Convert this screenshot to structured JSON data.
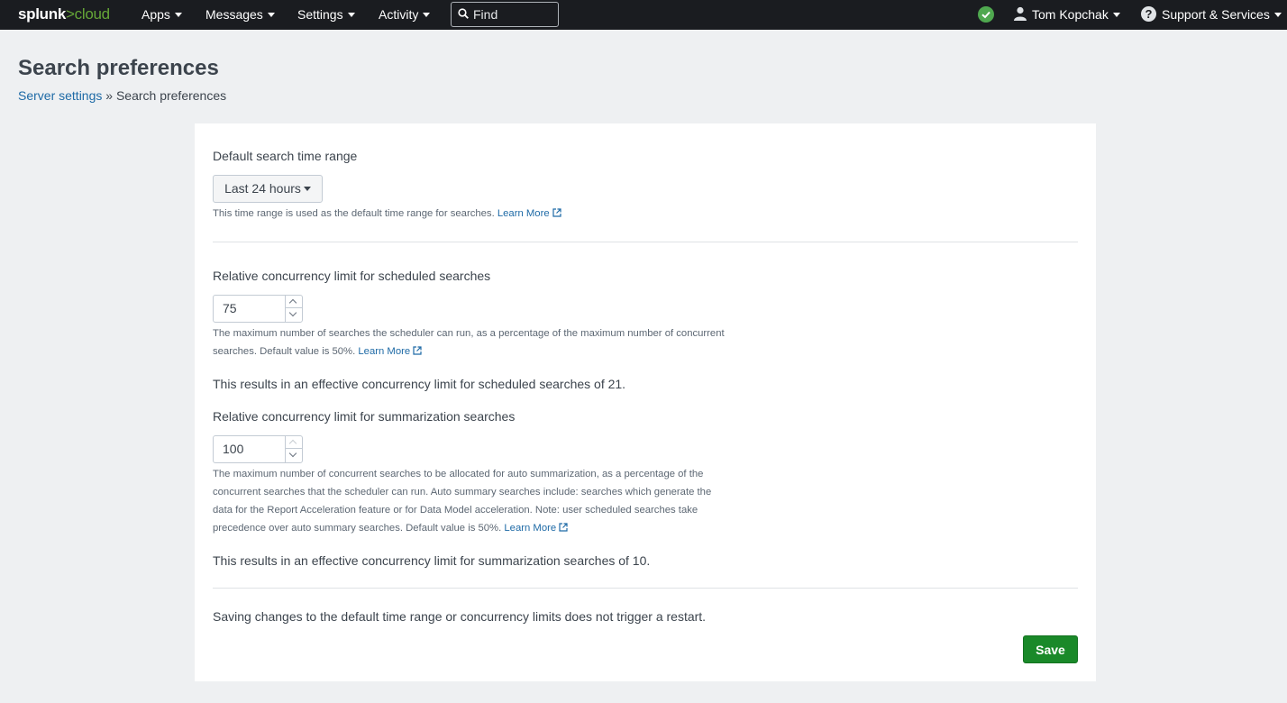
{
  "nav": {
    "logo_main": "splunk",
    "logo_sep": ">",
    "logo_sub": "cloud",
    "apps": "Apps",
    "messages": "Messages",
    "settings": "Settings",
    "activity": "Activity",
    "find_placeholder": "Find",
    "user": "Tom Kopchak",
    "support": "Support & Services",
    "status_color": "#4fa84f"
  },
  "header": {
    "title": "Search preferences",
    "breadcrumb_link": "Server settings",
    "breadcrumb_sep": " » ",
    "breadcrumb_current": "Search preferences"
  },
  "time_range": {
    "label": "Default search time range",
    "value": "Last 24 hours",
    "help": "This time range is used as the default time range for searches.",
    "learn_more": "Learn More"
  },
  "scheduled": {
    "label": "Relative concurrency limit for scheduled searches",
    "value": "75",
    "help_line1": "The maximum number of searches the scheduler can run, as a percentage of the maximum number of concurrent",
    "help_line2": "searches. Default value is 50%.",
    "learn_more": "Learn More",
    "result": "This results in an effective concurrency limit for scheduled searches of 21."
  },
  "summarization": {
    "label": "Relative concurrency limit for summarization searches",
    "value": "100",
    "help_line1": "The maximum number of concurrent searches to be allocated for auto summarization, as a percentage of the",
    "help_line2": "concurrent searches that the scheduler can run. Auto summary searches include: searches which generate the",
    "help_line3": "data for the Report Acceleration feature or for Data Model acceleration. Note: user scheduled searches take",
    "help_line4": "precedence over auto summary searches. Default value is 50%.",
    "learn_more": "Learn More",
    "result": "This results in an effective concurrency limit for summarization searches of 10."
  },
  "footer": {
    "note": "Saving changes to the default time range or concurrency limits does not trigger a restart.",
    "save": "Save",
    "save_color": "#1a8929"
  }
}
